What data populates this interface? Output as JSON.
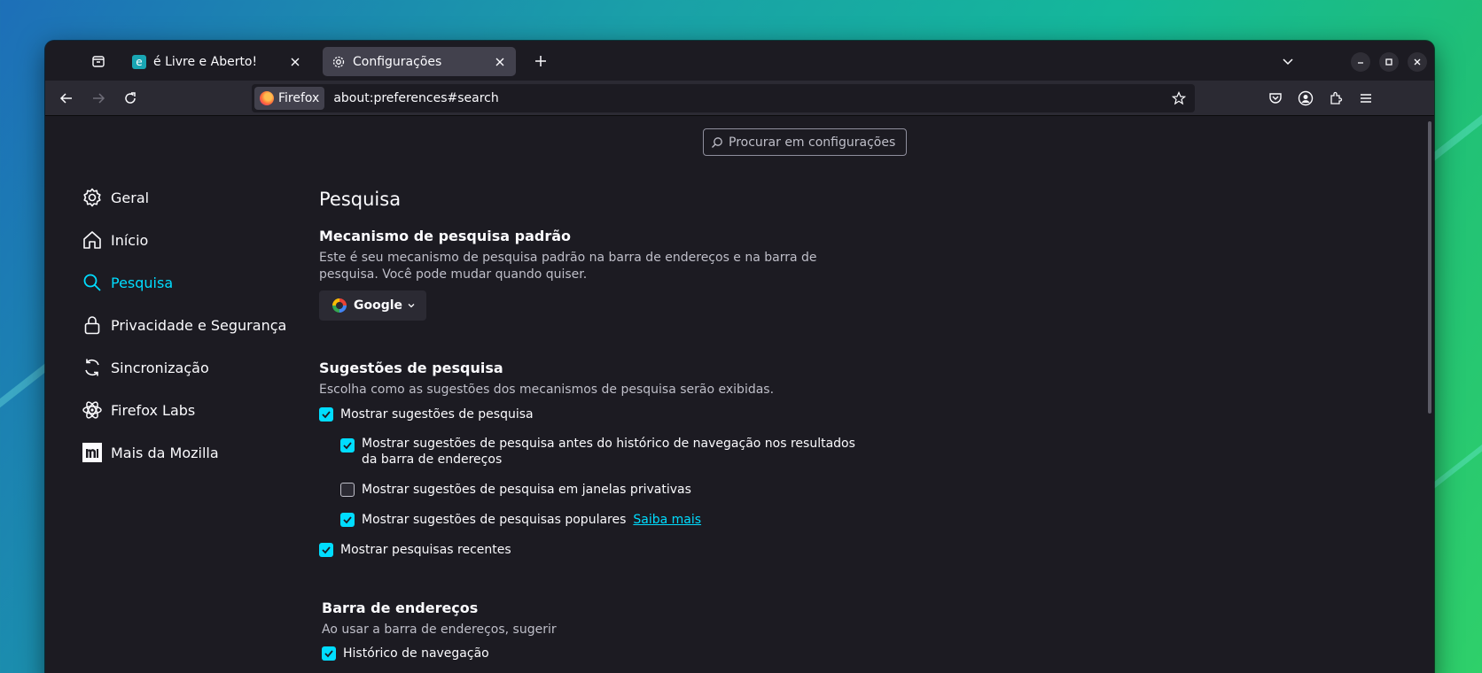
{
  "colors": {
    "accent": "#00ddff",
    "window_bg": "#1c1b22",
    "toolbar_bg": "#2b2a33"
  },
  "tabs": [
    {
      "title": "é Livre e Aberto!",
      "icon": "site-favicon",
      "active": false
    },
    {
      "title": "Configurações",
      "icon": "gear-icon",
      "active": true
    }
  ],
  "urlbar": {
    "identity_label": "Firefox",
    "url": "about:preferences#search"
  },
  "search": {
    "placeholder": "Procurar em configurações"
  },
  "sidebar": {
    "items": [
      {
        "label": "Geral",
        "icon": "gear-icon",
        "selected": false
      },
      {
        "label": "Início",
        "icon": "home-icon",
        "selected": false
      },
      {
        "label": "Pesquisa",
        "icon": "search-icon",
        "selected": true
      },
      {
        "label": "Privacidade e Segurança",
        "icon": "lock-icon",
        "selected": false
      },
      {
        "label": "Sincronização",
        "icon": "sync-icon",
        "selected": false
      },
      {
        "label": "Firefox Labs",
        "icon": "labs-icon",
        "selected": false
      },
      {
        "label": "Mais da Mozilla",
        "icon": "mozilla-icon",
        "selected": false
      }
    ]
  },
  "main": {
    "title": "Pesquisa",
    "default_engine": {
      "heading": "Mecanismo de pesquisa padrão",
      "description": "Este é seu mecanismo de pesquisa padrão na barra de endereços e na barra de pesquisa. Você pode mudar quando quiser.",
      "selected_engine": "Google"
    },
    "suggestions": {
      "heading": "Sugestões de pesquisa",
      "description": "Escolha como as sugestões dos mecanismos de pesquisa serão exibidas.",
      "options": [
        {
          "label": "Mostrar sugestões de pesquisa",
          "checked": true
        },
        {
          "label": "Mostrar sugestões de pesquisa antes do histórico de navegação nos resultados da barra de endereços",
          "checked": true
        },
        {
          "label": "Mostrar sugestões de pesquisa em janelas privativas",
          "checked": false
        },
        {
          "label": "Mostrar sugestões de pesquisas populares",
          "checked": true,
          "link": "Saiba mais"
        },
        {
          "label": "Mostrar pesquisas recentes",
          "checked": true
        }
      ]
    },
    "address_bar": {
      "heading": "Barra de endereços",
      "description": "Ao usar a barra de endereços, sugerir",
      "options": [
        {
          "label": "Histórico de navegação",
          "checked": true
        }
      ]
    }
  }
}
